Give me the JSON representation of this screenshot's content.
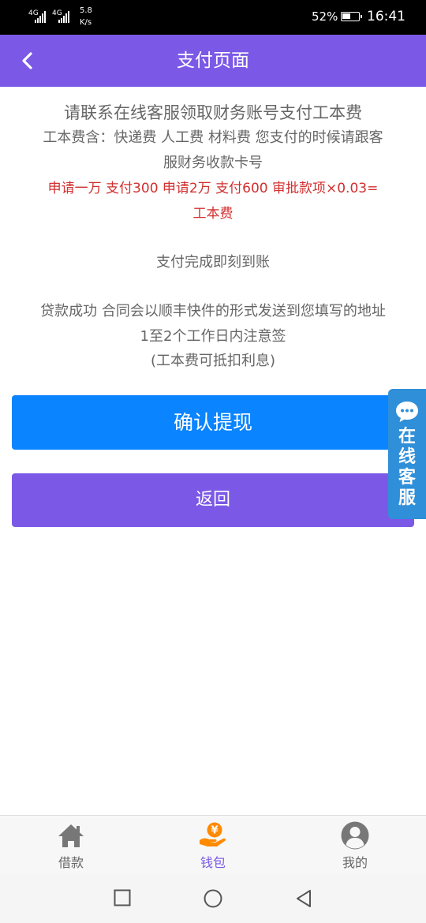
{
  "status_bar": {
    "network_1": "4G",
    "network_2": "4G",
    "speed_value": "5.8",
    "speed_unit": "K/s",
    "battery_percent": "52%",
    "battery_level": 0.52,
    "time": "16:41"
  },
  "header": {
    "title": "支付页面",
    "back_icon": "chevron-left-icon"
  },
  "notice": {
    "line1": "请联系在线客服领取财务账号支付工本费",
    "line2": "工本费含：快递费 人工费 材料费 您支付的时候请跟客",
    "line3": "服财务收款卡号",
    "red_line1": "申请一万 支付300  申请2万 支付600  审批款项×0.03=",
    "red_line2": "工本费",
    "arrival": "支付完成即刻到账",
    "contract_line1": "贷款成功 合同会以顺丰快件的形式发送到您填写的地址",
    "contract_line2": "1至2个工作日内注意签",
    "contract_line3": "(工本费可抵扣利息)"
  },
  "buttons": {
    "confirm": "确认提现",
    "back": "返回"
  },
  "float_service": {
    "label_chars": [
      "在",
      "线",
      "客",
      "服"
    ],
    "icon": "chat-bubble-icon"
  },
  "tabbar": {
    "items": [
      {
        "label": "借款",
        "icon": "house-icon",
        "active": false
      },
      {
        "label": "钱包",
        "icon": "yuan-hand-icon",
        "active": true
      },
      {
        "label": "我的",
        "icon": "user-avatar-icon",
        "active": false
      }
    ]
  },
  "colors": {
    "primary": "#7b59e6",
    "confirm_blue": "#0a84ff",
    "warning_red": "#d32f2f",
    "service_blue": "#2f8fd8",
    "active_orange": "#ff8a00"
  },
  "system_nav": {
    "buttons": [
      "recents-square-icon",
      "home-circle-icon",
      "back-triangle-icon"
    ]
  }
}
